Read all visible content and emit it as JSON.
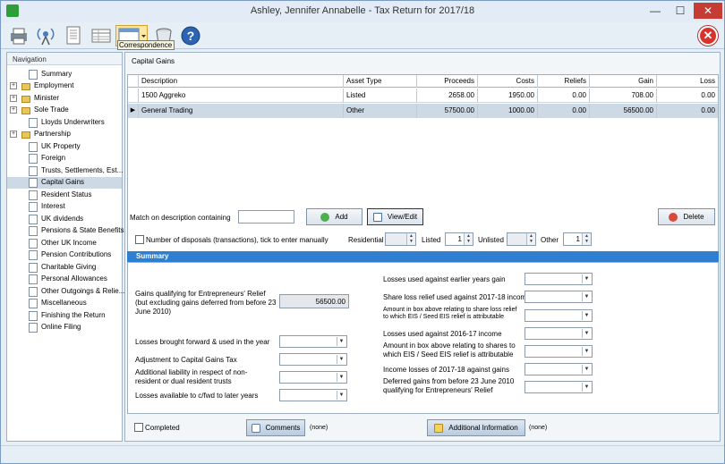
{
  "window": {
    "title": "Ashley, Jennifer Annabelle - Tax Return for 2017/18"
  },
  "toolbar": {
    "tooltip": "Correspondence",
    "exit_symbol": "✕"
  },
  "nav": {
    "header": "Navigation",
    "items": [
      {
        "label": "Summary"
      },
      {
        "label": "Employment"
      },
      {
        "label": "Minister"
      },
      {
        "label": "Sole Trade"
      },
      {
        "label": "Lloyds Underwriters"
      },
      {
        "label": "Partnership"
      },
      {
        "label": "UK Property"
      },
      {
        "label": "Foreign"
      },
      {
        "label": "Trusts, Settlements, Est..."
      },
      {
        "label": "Capital Gains"
      },
      {
        "label": "Resident Status"
      },
      {
        "label": "Interest"
      },
      {
        "label": "UK dividends"
      },
      {
        "label": "Pensions & State Benefits"
      },
      {
        "label": "Other UK Income"
      },
      {
        "label": "Pension Contributions"
      },
      {
        "label": "Charitable Giving"
      },
      {
        "label": "Personal Allowances"
      },
      {
        "label": "Other Outgoings & Relie..."
      },
      {
        "label": "Miscellaneous"
      },
      {
        "label": "Finishing the Return"
      },
      {
        "label": "Online Filing"
      }
    ]
  },
  "main": {
    "title": "Capital Gains",
    "grid": {
      "columns": [
        "Description",
        "Asset Type",
        "Proceeds",
        "Costs",
        "Reliefs",
        "Gain",
        "Loss"
      ],
      "rows": [
        {
          "marker": "",
          "cells": [
            "1500 Aggreko",
            "Listed",
            "2658.00",
            "1950.00",
            "0.00",
            "708.00",
            "0.00"
          ]
        },
        {
          "marker": "▶",
          "cells": [
            "General Trading",
            "Other",
            "57500.00",
            "1000.00",
            "0.00",
            "56500.00",
            "0.00"
          ]
        }
      ]
    },
    "filter_label": "Match on description containing",
    "filter_value": "",
    "add_label": "Add",
    "view_label": "View/Edit",
    "delete_label": "Delete",
    "disposals_label": "Number of disposals (transactions), tick to enter manually",
    "residential_label": "Residential",
    "residential_value": "",
    "listed_label": "Listed",
    "listed_value": "1",
    "unlisted_label": "Unlisted",
    "unlisted_value": "",
    "other_label": "Other",
    "other_value": "1"
  },
  "summary": {
    "title": "Summary",
    "left": [
      {
        "label": "Gains qualifying for Entrepreneurs' Relief (but excluding gains deferred from before 23 June 2010)",
        "value": "56500.00"
      },
      {
        "label": "Losses brought forward & used in the year"
      },
      {
        "label": "Adjustment to Capital Gains Tax"
      },
      {
        "label": "Additional liability in respect of non-resident or dual resident trusts"
      },
      {
        "label": "Losses available to c/fwd to later years"
      }
    ],
    "right": [
      {
        "label": "Losses used against earlier years gain"
      },
      {
        "label": "Share loss relief used against 2017-18 income"
      },
      {
        "label": "Amount in box above relating to share loss relief to which EIS / Seed EIS relief is attributable"
      },
      {
        "label": "Losses used against 2016-17 income"
      },
      {
        "label": "Amount in box above relating to shares to which EIS / Seed EIS relief is attributable"
      },
      {
        "label": "Income losses of 2017-18 against gains"
      },
      {
        "label": "Deferred gains from before 23 June 2010 qualifying for Entrepreneurs' Relief"
      }
    ]
  },
  "bottom": {
    "completed_label": "Completed",
    "comments_label": "Comments",
    "comments_status": "(none)",
    "additional_label": "Additional Information",
    "additional_status": "(none)"
  }
}
